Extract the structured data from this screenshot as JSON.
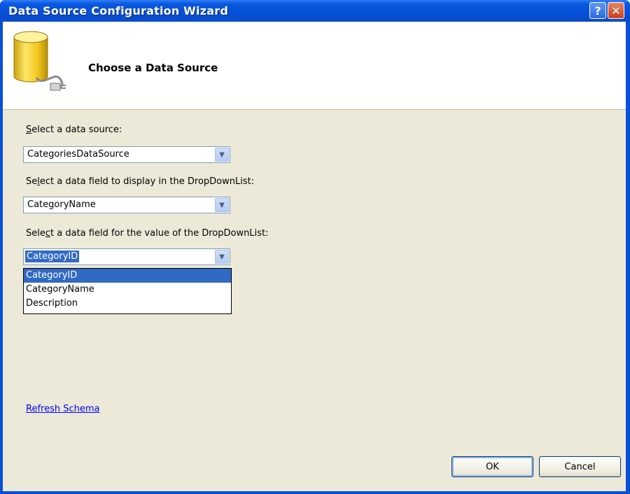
{
  "window": {
    "title": "Data Source Configuration Wizard",
    "help_label": "?",
    "close_label": "✕"
  },
  "header": {
    "title": "Choose a Data Source",
    "icon": "database-icon"
  },
  "form": {
    "data_source": {
      "label_prefix": "",
      "label_key": "S",
      "label_rest": "elect a data source:",
      "value": "CategoriesDataSource"
    },
    "display_field": {
      "label_prefix": "Se",
      "label_key": "l",
      "label_rest": "ect a data field to display in the DropDownList:",
      "value": "CategoryName"
    },
    "value_field": {
      "label_prefix": "Sele",
      "label_key": "c",
      "label_rest": "t a data field for the value of the DropDownList:",
      "value": "CategoryID",
      "options": [
        "CategoryID",
        "CategoryName",
        "Description"
      ]
    }
  },
  "links": {
    "refresh_schema": "Refresh Schema"
  },
  "buttons": {
    "ok": "OK",
    "cancel": "Cancel"
  },
  "colors": {
    "titlebar": "#0550d6",
    "selection": "#316ac5",
    "dialog_bg": "#ece9d8"
  }
}
